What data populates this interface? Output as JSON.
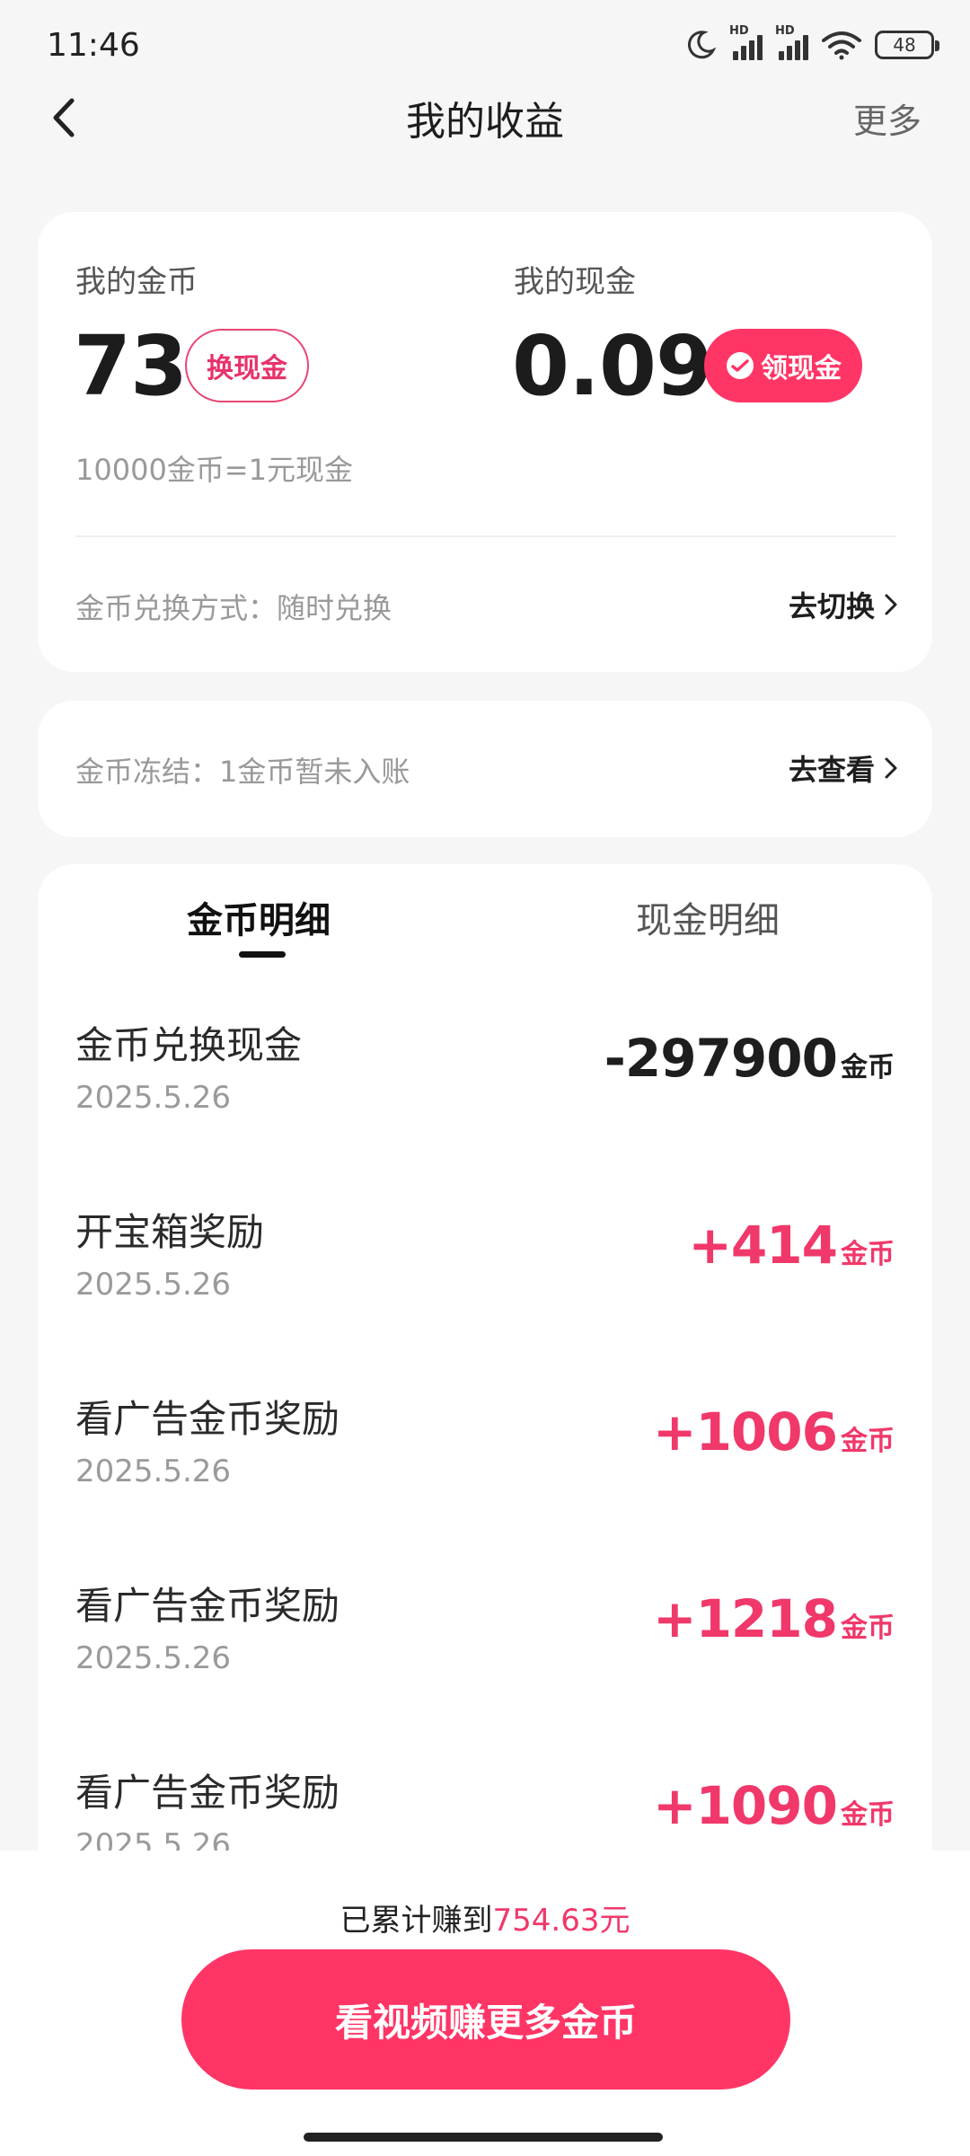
{
  "status_bar": {
    "time": "11:46",
    "battery": "48",
    "signal_label": "HD"
  },
  "nav": {
    "title": "我的收益",
    "more": "更多"
  },
  "summary": {
    "coins_label": "我的金币",
    "coins_value": "73",
    "exchange_button": "换现金",
    "cash_label": "我的现金",
    "cash_value": "0.09",
    "claim_button": "领现金",
    "rate_text": "10000金币=1元现金",
    "exchange_mode_text": "金币兑换方式：随时兑换",
    "switch_link": "去切换"
  },
  "freeze": {
    "text": "金币冻结：1金币暂未入账",
    "view_link": "去查看"
  },
  "tabs": {
    "coins_detail": "金币明细",
    "cash_detail": "现金明细"
  },
  "transactions": [
    {
      "title": "金币兑换现金",
      "date": "2025.5.26",
      "amount": "-297900",
      "unit": "金币",
      "sign": "negative"
    },
    {
      "title": "开宝箱奖励",
      "date": "2025.5.26",
      "amount": "+414",
      "unit": "金币",
      "sign": "positive"
    },
    {
      "title": "看广告金币奖励",
      "date": "2025.5.26",
      "amount": "+1006",
      "unit": "金币",
      "sign": "positive"
    },
    {
      "title": "看广告金币奖励",
      "date": "2025.5.26",
      "amount": "+1218",
      "unit": "金币",
      "sign": "positive"
    },
    {
      "title": "看广告金币奖励",
      "date": "2025.5.26",
      "amount": "+1090",
      "unit": "金币",
      "sign": "positive"
    }
  ],
  "bottom": {
    "earned_prefix": "已累计赚到",
    "earned_amount": "754.63元",
    "cta_button": "看视频赚更多金币"
  },
  "colors": {
    "accent": "#ff3566",
    "positive_amount": "#f0386a",
    "background": "#f6f6f6"
  }
}
